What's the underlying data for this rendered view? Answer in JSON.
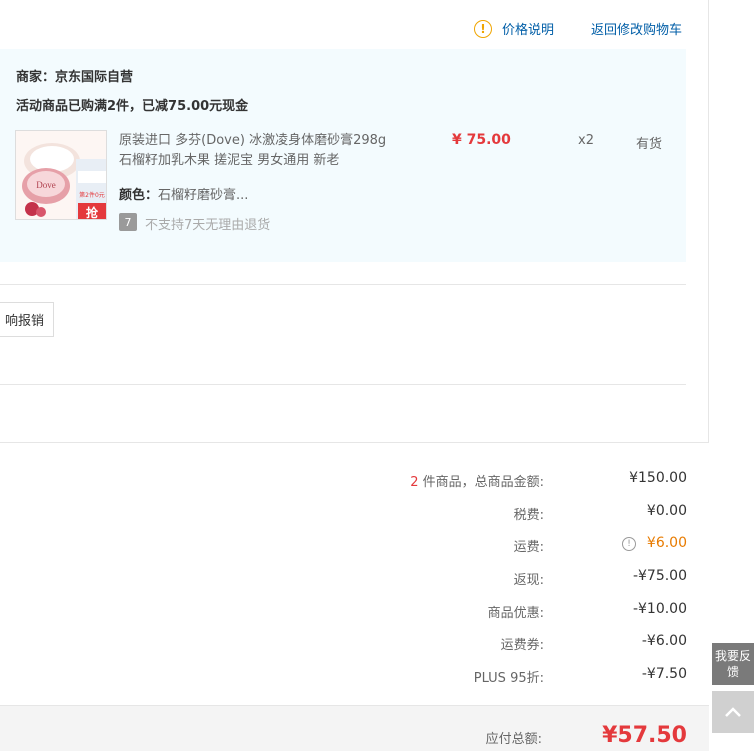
{
  "header": {
    "price_note": "价格说明",
    "back_to_cart": "返回修改购物车"
  },
  "shop": {
    "merchant": "商家：京东国际自营",
    "promotion": "活动商品已购满2件，已减75.00元现金"
  },
  "product": {
    "title": "原装进口 多芬(Dove) 冰激凌身体磨砂膏298g 石榴籽加乳木果 搓泥宝 男女通用 新老",
    "color_label": "颜色：",
    "color_value": "石榴籽磨砂膏...",
    "return_badge": "7",
    "return_policy": "不支持7天无理由退货",
    "price": "¥ 75.00",
    "quantity": "x2",
    "stock": "有货",
    "image_brand": "Dove",
    "image_tag": "抢",
    "image_promo": "第2件0元"
  },
  "invoice": {
    "button_label": "响报销"
  },
  "summary": {
    "count": "2",
    "items_label": "件商品，总商品金额:",
    "items_total": "¥150.00",
    "tax_label": "税费:",
    "tax_value": "¥0.00",
    "shipping_label": "运费:",
    "shipping_value": "¥6.00",
    "rebate_label": "返现:",
    "rebate_value": "-¥75.00",
    "discount_label": "商品优惠:",
    "discount_value": "-¥10.00",
    "ship_coupon_label": "运费券:",
    "ship_coupon_value": "-¥6.00",
    "plus_label": "PLUS 95折:",
    "plus_value": "-¥7.50",
    "total_label": "应付总额:",
    "total_value": "¥57.50"
  },
  "floating": {
    "feedback": "我要反馈"
  },
  "colors": {
    "accent_red": "#e4393c",
    "link_blue": "#005ea7",
    "warning_orange": "#e87b00",
    "panel_bg": "#f3fbfe"
  }
}
